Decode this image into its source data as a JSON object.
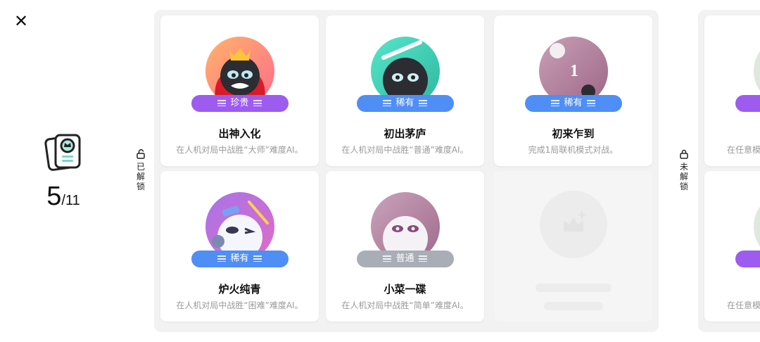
{
  "close": {
    "icon": "close-icon"
  },
  "progress": {
    "unlocked": "5",
    "total": "/11",
    "icon": "trophy-card-icon"
  },
  "sections": {
    "unlocked": {
      "label_chars": [
        "已",
        "解",
        "锁"
      ],
      "icon": "unlock-icon"
    },
    "locked": {
      "label_chars": [
        "未",
        "解",
        "锁"
      ],
      "icon": "lock-icon"
    }
  },
  "achievements": [
    {
      "title": "出神入化",
      "tier": "珍贵",
      "desc": "在人机对局中战胜“大师”难度AI。",
      "tier_color": "#9d5bf0"
    },
    {
      "title": "初出茅庐",
      "tier": "稀有",
      "desc": "在人机对局中战胜“普通”难度AI。",
      "tier_color": "#4f8ef5"
    },
    {
      "title": "初来乍到",
      "tier": "稀有",
      "desc": "完成1局联机模式对战。",
      "tier_color": "#4f8ef5"
    },
    {
      "title": "炉火纯青",
      "tier": "稀有",
      "desc": "在人机对局中战胜“困难”难度AI。",
      "tier_color": "#4f8ef5"
    },
    {
      "title": "小菜一碟",
      "tier": "普通",
      "desc": "在人机对局中战胜“简单”难度AI。",
      "tier_color": "#a9adb6"
    }
  ],
  "locked_achievements": [
    {
      "desc": "在任意模",
      "tier_color": "#9d5bf0"
    },
    {
      "desc": "在任意模",
      "tier_color": "#9d5bf0"
    }
  ],
  "colors": {
    "precious": "#9d5bf0",
    "rare": "#4f8ef5",
    "common": "#a9adb6",
    "panel_bg": "#f2f2f2"
  }
}
